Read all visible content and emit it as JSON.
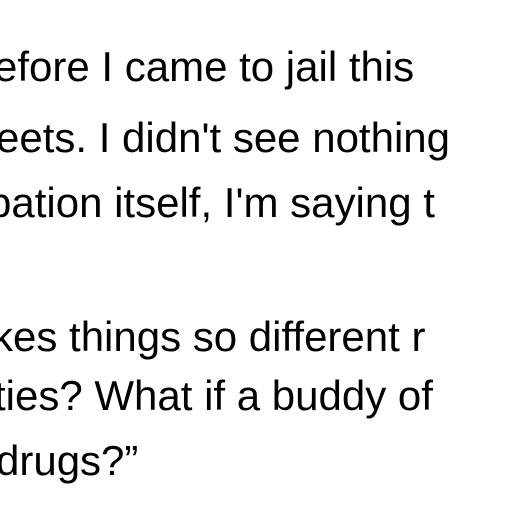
{
  "paragraph_1": {
    "lines": [
      "efore I came to jail this",
      "eets. I didn't see nothing",
      "pation itself, I'm saying t"
    ]
  },
  "paragraph_2": {
    "lines": [
      "kes things so different r",
      "ties? What if a buddy of",
      "drugs?”"
    ]
  }
}
